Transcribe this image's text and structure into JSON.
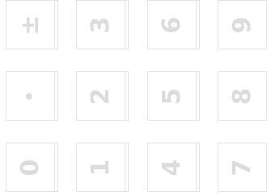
{
  "keypad": {
    "keys": {
      "plusminus": "±",
      "three": "3",
      "six": "6",
      "nine": "9",
      "dot": "•",
      "two": "2",
      "five": "5",
      "eight": "8",
      "zero": "0",
      "one": "1",
      "four": "4",
      "seven": "7"
    }
  }
}
